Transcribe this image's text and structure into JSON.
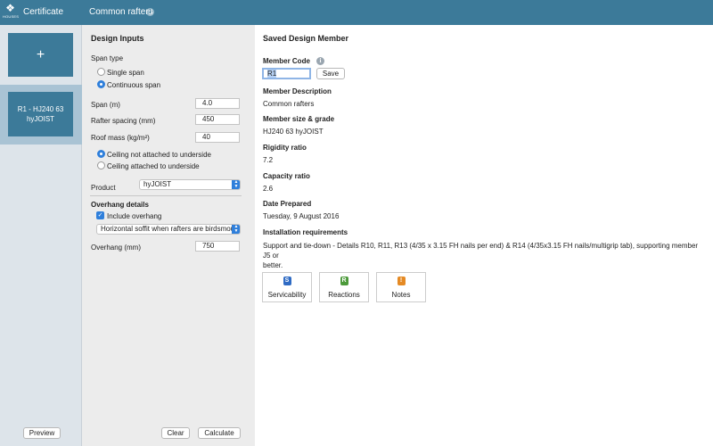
{
  "header": {
    "logo_text": "HOUSES",
    "app_title": "Certificate",
    "page_title": "Common rafters",
    "info_glyph": "i",
    "colors": {
      "bar": "#3c7a99",
      "accent": "#2f7fdb"
    }
  },
  "sidebar": {
    "add_glyph": "+",
    "members": [
      {
        "line1": "R1 - HJ240 63",
        "line2": "hyJOIST"
      }
    ],
    "preview_label": "Preview"
  },
  "inputs": {
    "title": "Design Inputs",
    "span_type": {
      "label": "Span type",
      "options": [
        "Single span",
        "Continuous span"
      ],
      "selected": "Continuous span"
    },
    "span": {
      "label": "Span (m)",
      "value": "4.0"
    },
    "rafter_spacing": {
      "label": "Rafter spacing (mm)",
      "value": "450"
    },
    "roof_mass": {
      "label": "Roof mass (kg/m²)",
      "value": "40"
    },
    "ceiling": {
      "options": [
        "Ceiling not attached to underside",
        "Ceiling attached to underside"
      ],
      "selected": "Ceiling not attached to underside"
    },
    "product": {
      "label": "Product",
      "value": "hyJOIST"
    },
    "overhang": {
      "title": "Overhang details",
      "include_label": "Include overhang",
      "include_checked": true,
      "soffit_value": "Horizontal soffit when rafters are birdsmou…",
      "length_label": "Overhang (mm)",
      "length_value": "750"
    },
    "clear_label": "Clear",
    "calculate_label": "Calculate"
  },
  "saved": {
    "title": "Saved Design Member",
    "member_code": {
      "label": "Member Code",
      "value": "R1",
      "save_label": "Save",
      "info_glyph": "i"
    },
    "description": {
      "label": "Member Description",
      "value": "Common rafters"
    },
    "size_grade": {
      "label": "Member size & grade",
      "value": "HJ240 63 hyJOIST"
    },
    "rigidity": {
      "label": "Rigidity ratio",
      "value": "7.2"
    },
    "capacity": {
      "label": "Capacity ratio",
      "value": "2.6"
    },
    "date": {
      "label": "Date Prepared",
      "value": "Tuesday, 9 August 2016"
    },
    "installation": {
      "label": "Installation requirements",
      "line1": "Support and tie-down - Details R10, R11, R13 (4/35 x 3.15 FH nails per end) & R14 (4/35x3.15 FH nails/multigrip tab), supporting member J5 or",
      "line2": "better."
    },
    "tools": [
      {
        "label": "Servicability",
        "badge": "S",
        "color": "#2f6bc4"
      },
      {
        "label": "Reactions",
        "badge": "R",
        "color": "#4c9a3a"
      },
      {
        "label": "Notes",
        "badge": "!",
        "color": "#e58a24"
      }
    ]
  }
}
